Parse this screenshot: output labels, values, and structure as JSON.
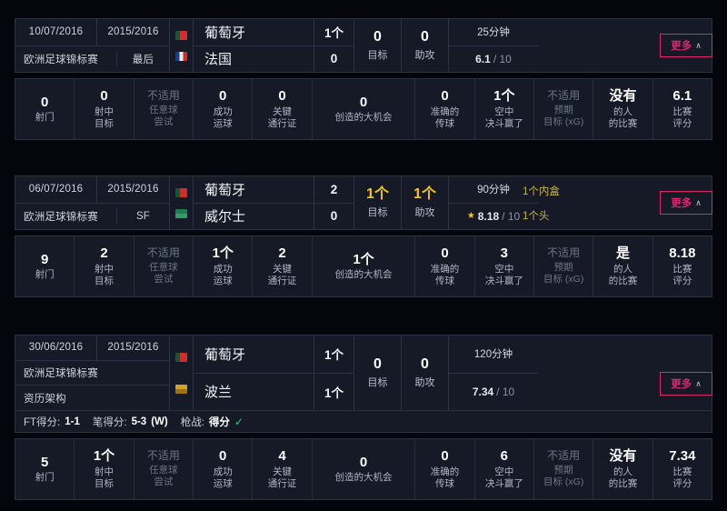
{
  "theme": {
    "bg": "#04060c",
    "panel": "#151a26",
    "border": "#2b3243",
    "accent_pink": "#e0256c",
    "gold": "#f5c518",
    "muted": "#6d7586",
    "green_tick": "#2ecc71"
  },
  "labels": {
    "goals": "目标",
    "assists": "助攻",
    "more": "更多",
    "chevron_up": "∧",
    "rating_denominator": "/ 10",
    "ft_score_label": "FT得分:",
    "pen_score_label": "笔得分:",
    "shootout_label": "枪战:",
    "shootout_value": "得分"
  },
  "stat_columns": [
    {
      "key": "shots",
      "label": "射门"
    },
    {
      "key": "shots_on_target",
      "label": "射中\n目标"
    },
    {
      "key": "free_kick_attempts",
      "label": "任意球\n尝试"
    },
    {
      "key": "successful_dribbles",
      "label": "成功\n运球"
    },
    {
      "key": "key_passes",
      "label": "关键\n通行证"
    },
    {
      "key": "big_chances_created",
      "label": "创造的大机会"
    },
    {
      "key": "accurate_passes",
      "label": "准确的\n传球"
    },
    {
      "key": "aerial_duels_won",
      "label": "空中\n决斗赢了"
    },
    {
      "key": "expected_goals",
      "label": "预期\n目标 (xG)"
    },
    {
      "key": "man_of_the_match",
      "label": "的人\n的比赛"
    },
    {
      "key": "match_rating",
      "label": "比赛\n评分"
    }
  ],
  "matches": [
    {
      "date": "10/07/2016",
      "season": "2015/2016",
      "competition": "欧洲足球锦标赛",
      "stage": "最后",
      "home": {
        "name": "葡萄牙",
        "score": "1个",
        "flag": "por"
      },
      "away": {
        "name": "法国",
        "score": "0",
        "flag": "fra"
      },
      "goals": "0",
      "goals_gold": false,
      "assists": "0",
      "assists_gold": false,
      "minutes": "25分钟",
      "rating": "6.1",
      "rating_star": false,
      "events": [],
      "ft_line": null,
      "stats": {
        "shots": "0",
        "shots_on_target": "0",
        "free_kick_attempts": "不适用",
        "successful_dribbles": "0",
        "key_passes": "0",
        "big_chances_created": "0",
        "accurate_passes": "0",
        "aerial_duels_won": "1个",
        "expected_goals": "不适用",
        "man_of_the_match": "没有",
        "match_rating": "6.1"
      },
      "stat_flags": {
        "aerial_duels_won": "bold",
        "man_of_the_match": "bold"
      }
    },
    {
      "date": "06/07/2016",
      "season": "2015/2016",
      "competition": "欧洲足球锦标赛",
      "stage": "SF",
      "home": {
        "name": "葡萄牙",
        "score": "2",
        "flag": "por"
      },
      "away": {
        "name": "威尔士",
        "score": "0",
        "flag": "wal"
      },
      "goals": "1个",
      "goals_gold": true,
      "assists": "1个",
      "assists_gold": true,
      "minutes": "90分钟",
      "rating": "8.18",
      "rating_star": true,
      "events": [
        "1个内盒",
        "1个头"
      ],
      "ft_line": null,
      "stats": {
        "shots": "9",
        "shots_on_target": "2",
        "free_kick_attempts": "不适用",
        "successful_dribbles": "1个",
        "key_passes": "2",
        "big_chances_created": "1个",
        "accurate_passes": "0",
        "aerial_duels_won": "3",
        "expected_goals": "不适用",
        "man_of_the_match": "是",
        "match_rating": "8.18"
      },
      "stat_flags": {
        "man_of_the_match": "bold"
      }
    },
    {
      "date": "30/06/2016",
      "season": "2015/2016",
      "competition": "欧洲足球锦标赛",
      "stage": "资历架构",
      "home": {
        "name": "葡萄牙",
        "score": "1个",
        "flag": "por"
      },
      "away": {
        "name": "波兰",
        "score": "1个",
        "flag": "pol"
      },
      "goals": "0",
      "goals_gold": false,
      "assists": "0",
      "assists_gold": false,
      "minutes": "120分钟",
      "rating": "7.34",
      "rating_star": false,
      "events": [],
      "ft_line": {
        "ft": "1-1",
        "pen": "5-3",
        "pen_result": "(W)",
        "shootout": "得分"
      },
      "stats": {
        "shots": "5",
        "shots_on_target": "1个",
        "free_kick_attempts": "不适用",
        "successful_dribbles": "0",
        "key_passes": "4",
        "big_chances_created": "0",
        "accurate_passes": "0",
        "aerial_duels_won": "6",
        "expected_goals": "不适用",
        "man_of_the_match": "没有",
        "match_rating": "7.34"
      },
      "stat_flags": {
        "shots_on_target": "bold",
        "man_of_the_match": "bold"
      }
    }
  ]
}
